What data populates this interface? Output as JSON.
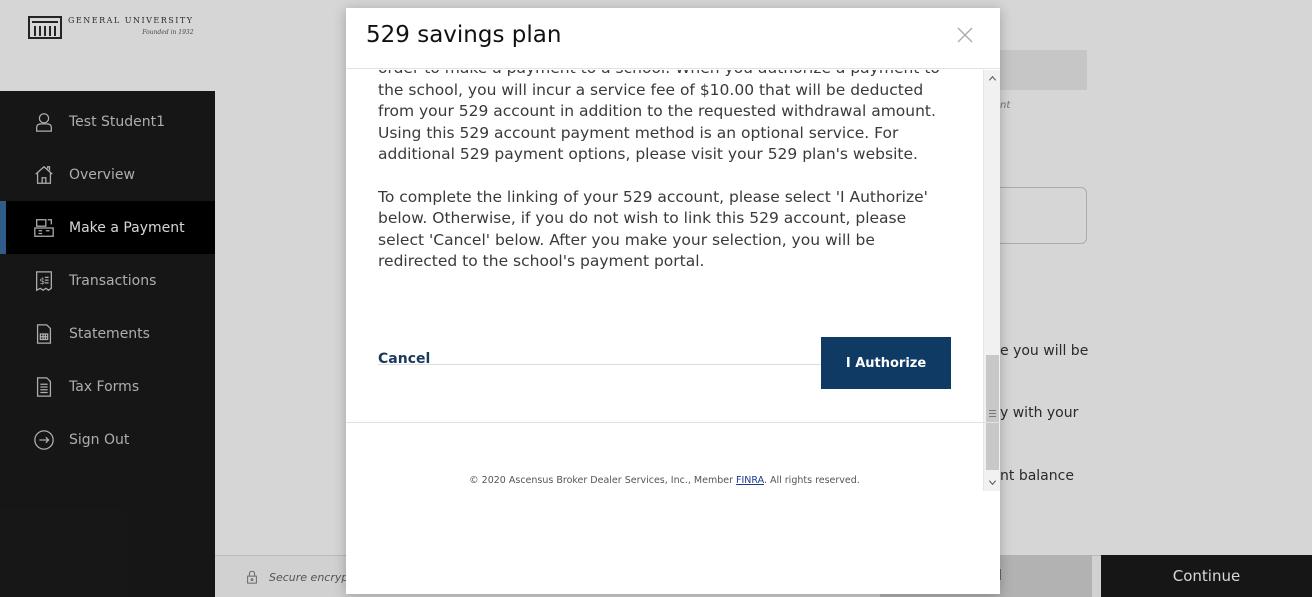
{
  "brand": {
    "name": "GENERAL UNIVERSITY",
    "tagline": "Founded in 1932"
  },
  "sidebar": {
    "items": [
      {
        "label": "Test Student1",
        "icon": "user-icon"
      },
      {
        "label": "Overview",
        "icon": "home-icon"
      },
      {
        "label": "Make a Payment",
        "icon": "register-icon",
        "active": true
      },
      {
        "label": "Transactions",
        "icon": "dollar-receipt-icon"
      },
      {
        "label": "Statements",
        "icon": "document-table-icon"
      },
      {
        "label": "Tax Forms",
        "icon": "document-list-icon"
      },
      {
        "label": "Sign Out",
        "icon": "sign-out-icon"
      }
    ]
  },
  "background": {
    "hint_fragment": "nt",
    "text_fragment_1": "e you will be",
    "text_fragment_2": "y with your",
    "text_fragment_3": "nt balance",
    "secure_text": "Secure encryp",
    "cancel_fragment": "el",
    "continue_label": "Continue"
  },
  "modal": {
    "title": "529 savings plan",
    "paragraph_1": "order to make a payment to a school. When you authorize a payment to the school, you will incur a service fee of $10.00 that will be deducted from your 529 account in addition to the requested withdrawal amount. Using this 529 account payment method is an optional service. For additional 529 payment options, please visit your 529 plan's website.",
    "paragraph_2": "To complete the linking of your 529 account, please select 'I Authorize' below. Otherwise, if you do not wish to link this 529 account, please select 'Cancel' below. After you make your selection, you will be redirected to the school's payment portal.",
    "cancel_label": "Cancel",
    "authorize_label": "I Authorize",
    "copyright_prefix": "© 2020 Ascensus Broker Dealer Services, Inc., Member ",
    "copyright_link": "FINRA",
    "copyright_suffix": ". All rights reserved."
  },
  "colors": {
    "sidebar_bg": "#1b1b1b",
    "accent": "#0f3a63",
    "active_indicator": "#3a6ea5"
  }
}
